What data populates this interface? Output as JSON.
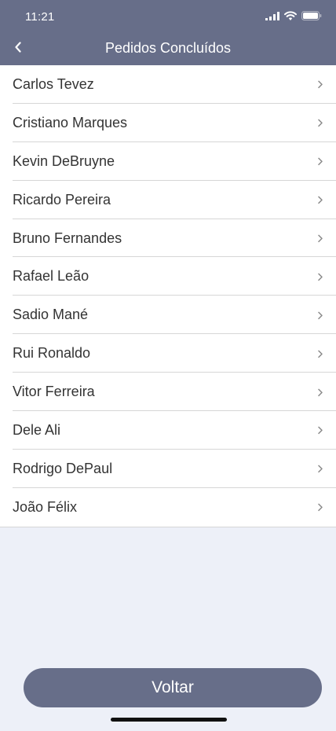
{
  "status_bar": {
    "time": "11:21",
    "icons": [
      "cellular-signal-icon",
      "wifi-icon",
      "battery-icon"
    ]
  },
  "header": {
    "title": "Pedidos Concluídos",
    "back_icon": "chevron-left-icon"
  },
  "orders": [
    {
      "name": "Carlos Tevez"
    },
    {
      "name": "Cristiano Marques"
    },
    {
      "name": "Kevin DeBruyne"
    },
    {
      "name": "Ricardo Pereira"
    },
    {
      "name": "Bruno Fernandes"
    },
    {
      "name": "Rafael Leão"
    },
    {
      "name": "Sadio Mané"
    },
    {
      "name": "Rui Ronaldo"
    },
    {
      "name": "Vitor Ferreira"
    },
    {
      "name": "Dele Ali"
    },
    {
      "name": "Rodrigo DePaul"
    },
    {
      "name": "João Félix"
    }
  ],
  "footer": {
    "button_label": "Voltar"
  },
  "colors": {
    "header_bg": "#676e89",
    "page_bg": "#edf0f8",
    "list_bg": "#ffffff",
    "divider": "#d6d6d6"
  }
}
